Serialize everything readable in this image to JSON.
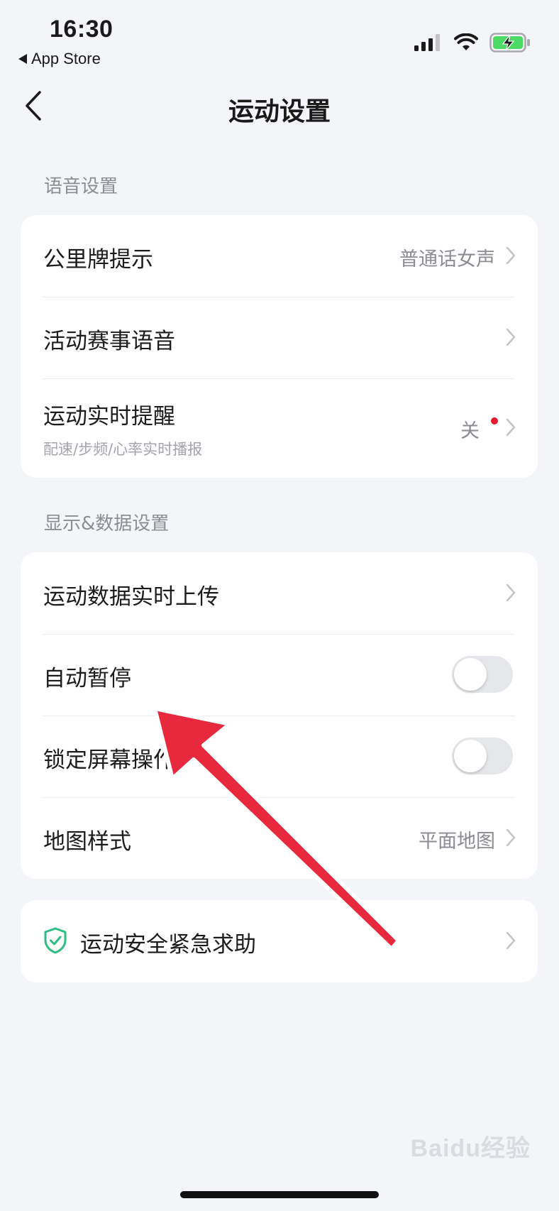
{
  "status_bar": {
    "time": "16:30",
    "back_app_label": "App Store"
  },
  "nav": {
    "title": "运动设置"
  },
  "sections": [
    {
      "label": "语音设置",
      "rows": [
        {
          "title": "公里牌提示",
          "value": "普通话女声"
        },
        {
          "title": "活动赛事语音"
        },
        {
          "title": "运动实时提醒",
          "subtitle": "配速/步频/心率实时播报",
          "value": "关"
        }
      ]
    },
    {
      "label": "显示&数据设置",
      "rows": [
        {
          "title": "运动数据实时上传"
        },
        {
          "title": "自动暂停",
          "toggle_on": false
        },
        {
          "title": "锁定屏幕操作",
          "toggle_on": false
        },
        {
          "title": "地图样式",
          "value": "平面地图"
        }
      ]
    },
    {
      "rows": [
        {
          "title": "运动安全紧急求助"
        }
      ]
    }
  ],
  "watermark": "Baidu经验",
  "colors": {
    "accent_red": "#e8192c",
    "shield_green": "#2ebd85",
    "arrow_red": "#e8283c"
  }
}
